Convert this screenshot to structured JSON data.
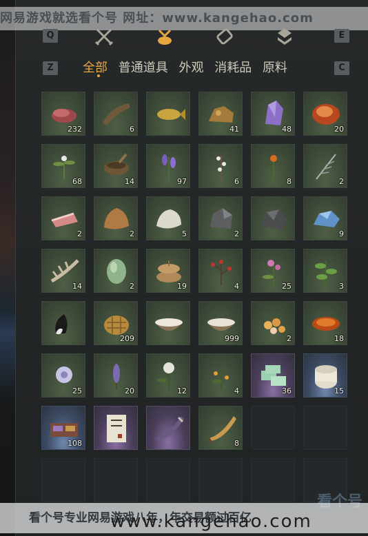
{
  "watermark_top": "网易游戏就选看个号  网址：www.kangehao.com",
  "watermark_bottom": "看个号专业网易游戏八年，年交易额过百亿",
  "watermark_url": "www.kangehao.com",
  "watermark_logo": "看个号",
  "keys": {
    "q": "Q",
    "e": "E",
    "z": "Z",
    "c": "C"
  },
  "tab_icons": [
    "swords-icon",
    "pouch-icon",
    "scroll-icon",
    "gem-icon"
  ],
  "active_tab": "pouch-icon",
  "categories": [
    "全部",
    "普通道具",
    "外观",
    "消耗品",
    "原料"
  ],
  "active_category": "全部",
  "items": [
    {
      "name": "raw-meat",
      "count": "232",
      "rarity": "green"
    },
    {
      "name": "catfish",
      "count": "6",
      "rarity": "green"
    },
    {
      "name": "golden-carp",
      "count": "",
      "rarity": "green"
    },
    {
      "name": "copper-ore",
      "count": "41",
      "rarity": "green"
    },
    {
      "name": "amethyst",
      "count": "48",
      "rarity": "green"
    },
    {
      "name": "red-agate",
      "count": "20",
      "rarity": "green"
    },
    {
      "name": "white-herb",
      "count": "68",
      "rarity": "green"
    },
    {
      "name": "mortar-herbs",
      "count": "14",
      "rarity": "green"
    },
    {
      "name": "lavender",
      "count": "97",
      "rarity": "green"
    },
    {
      "name": "white-blossom",
      "count": "6",
      "rarity": "green"
    },
    {
      "name": "orange-flower",
      "count": "8",
      "rarity": "green"
    },
    {
      "name": "silver-grass",
      "count": "2",
      "rarity": "green"
    },
    {
      "name": "pork-slice",
      "count": "2",
      "rarity": "green"
    },
    {
      "name": "brown-pelt",
      "count": "2",
      "rarity": "green"
    },
    {
      "name": "white-pelt",
      "count": "5",
      "rarity": "green"
    },
    {
      "name": "iron-ore",
      "count": "2",
      "rarity": "green"
    },
    {
      "name": "dark-stone",
      "count": "",
      "rarity": "green"
    },
    {
      "name": "blue-crystal",
      "count": "9",
      "rarity": "green"
    },
    {
      "name": "rib-bones",
      "count": "14",
      "rarity": "green"
    },
    {
      "name": "melon",
      "count": "2",
      "rarity": "green"
    },
    {
      "name": "rice-sacks",
      "count": "19",
      "rarity": "green"
    },
    {
      "name": "red-berry-plant",
      "count": "4",
      "rarity": "green"
    },
    {
      "name": "pink-flower",
      "count": "25",
      "rarity": "green"
    },
    {
      "name": "green-herb",
      "count": "3",
      "rarity": "green"
    },
    {
      "name": "fox-tail",
      "count": "",
      "rarity": "green"
    },
    {
      "name": "wicker-basket",
      "count": "209",
      "rarity": "green"
    },
    {
      "name": "milk-bowl",
      "count": "",
      "rarity": "green"
    },
    {
      "name": "rice-bowl",
      "count": "999",
      "rarity": "green"
    },
    {
      "name": "dried-fruits",
      "count": "2",
      "rarity": "green"
    },
    {
      "name": "fried-meat",
      "count": "18",
      "rarity": "green"
    },
    {
      "name": "chrysanthemum",
      "count": "25",
      "rarity": "green"
    },
    {
      "name": "purple-spike",
      "count": "20",
      "rarity": "green"
    },
    {
      "name": "white-peony",
      "count": "12",
      "rarity": "green"
    },
    {
      "name": "orange-berry",
      "count": "4",
      "rarity": "green"
    },
    {
      "name": "cash-bundles",
      "count": "36",
      "rarity": "purple"
    },
    {
      "name": "porcelain-jar",
      "count": "15",
      "rarity": "blue"
    },
    {
      "name": "gift-box",
      "count": "108",
      "rarity": "blue"
    },
    {
      "name": "scroll",
      "count": "",
      "rarity": "purple"
    },
    {
      "name": "horn-purple",
      "count": "",
      "rarity": "purple"
    },
    {
      "name": "horn-gold",
      "count": "8",
      "rarity": "green"
    },
    {
      "name": "",
      "count": "",
      "rarity": "empty"
    },
    {
      "name": "",
      "count": "",
      "rarity": "empty"
    },
    {
      "name": "",
      "count": "",
      "rarity": "empty"
    },
    {
      "name": "",
      "count": "",
      "rarity": "empty"
    },
    {
      "name": "",
      "count": "",
      "rarity": "empty"
    },
    {
      "name": "",
      "count": "",
      "rarity": "empty"
    },
    {
      "name": "",
      "count": "",
      "rarity": "empty"
    },
    {
      "name": "",
      "count": "",
      "rarity": "empty"
    }
  ]
}
